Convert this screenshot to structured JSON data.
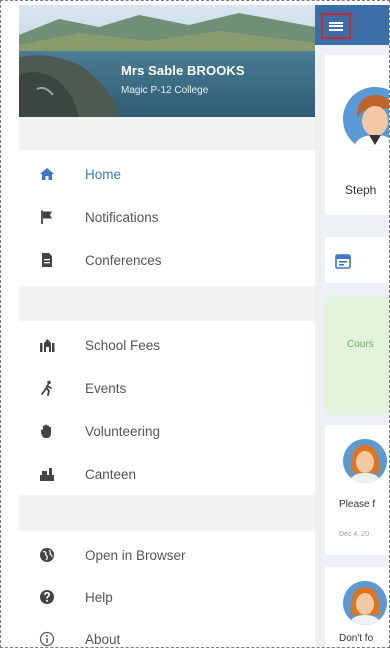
{
  "drawer": {
    "user_name": "Mrs Sable BROOKS",
    "school": "Magic P-12 College",
    "groups": [
      [
        {
          "label": "Home",
          "icon": "home-icon",
          "active": true
        },
        {
          "label": "Notifications",
          "icon": "notification-flag-icon"
        },
        {
          "label": "Conferences",
          "icon": "document-icon"
        }
      ],
      [
        {
          "label": "School Fees",
          "icon": "school-fees-icon"
        },
        {
          "label": "Events",
          "icon": "events-runner-icon"
        },
        {
          "label": "Volunteering",
          "icon": "hand-icon"
        },
        {
          "label": "Canteen",
          "icon": "canteen-icon"
        }
      ],
      [
        {
          "label": "Open in Browser",
          "icon": "globe-icon"
        },
        {
          "label": "Help",
          "icon": "help-icon"
        },
        {
          "label": "About",
          "icon": "info-icon"
        }
      ]
    ]
  },
  "content": {
    "profile_name": "Steph",
    "course_text": "Cours",
    "messages": [
      {
        "text": "Please f",
        "date": "Dec 4, 20"
      },
      {
        "text": "Don't fo"
      }
    ]
  },
  "colors": {
    "accent": "#3c78c3",
    "topbar": "#3d6ea8",
    "course_bg": "#e3f3dc"
  }
}
